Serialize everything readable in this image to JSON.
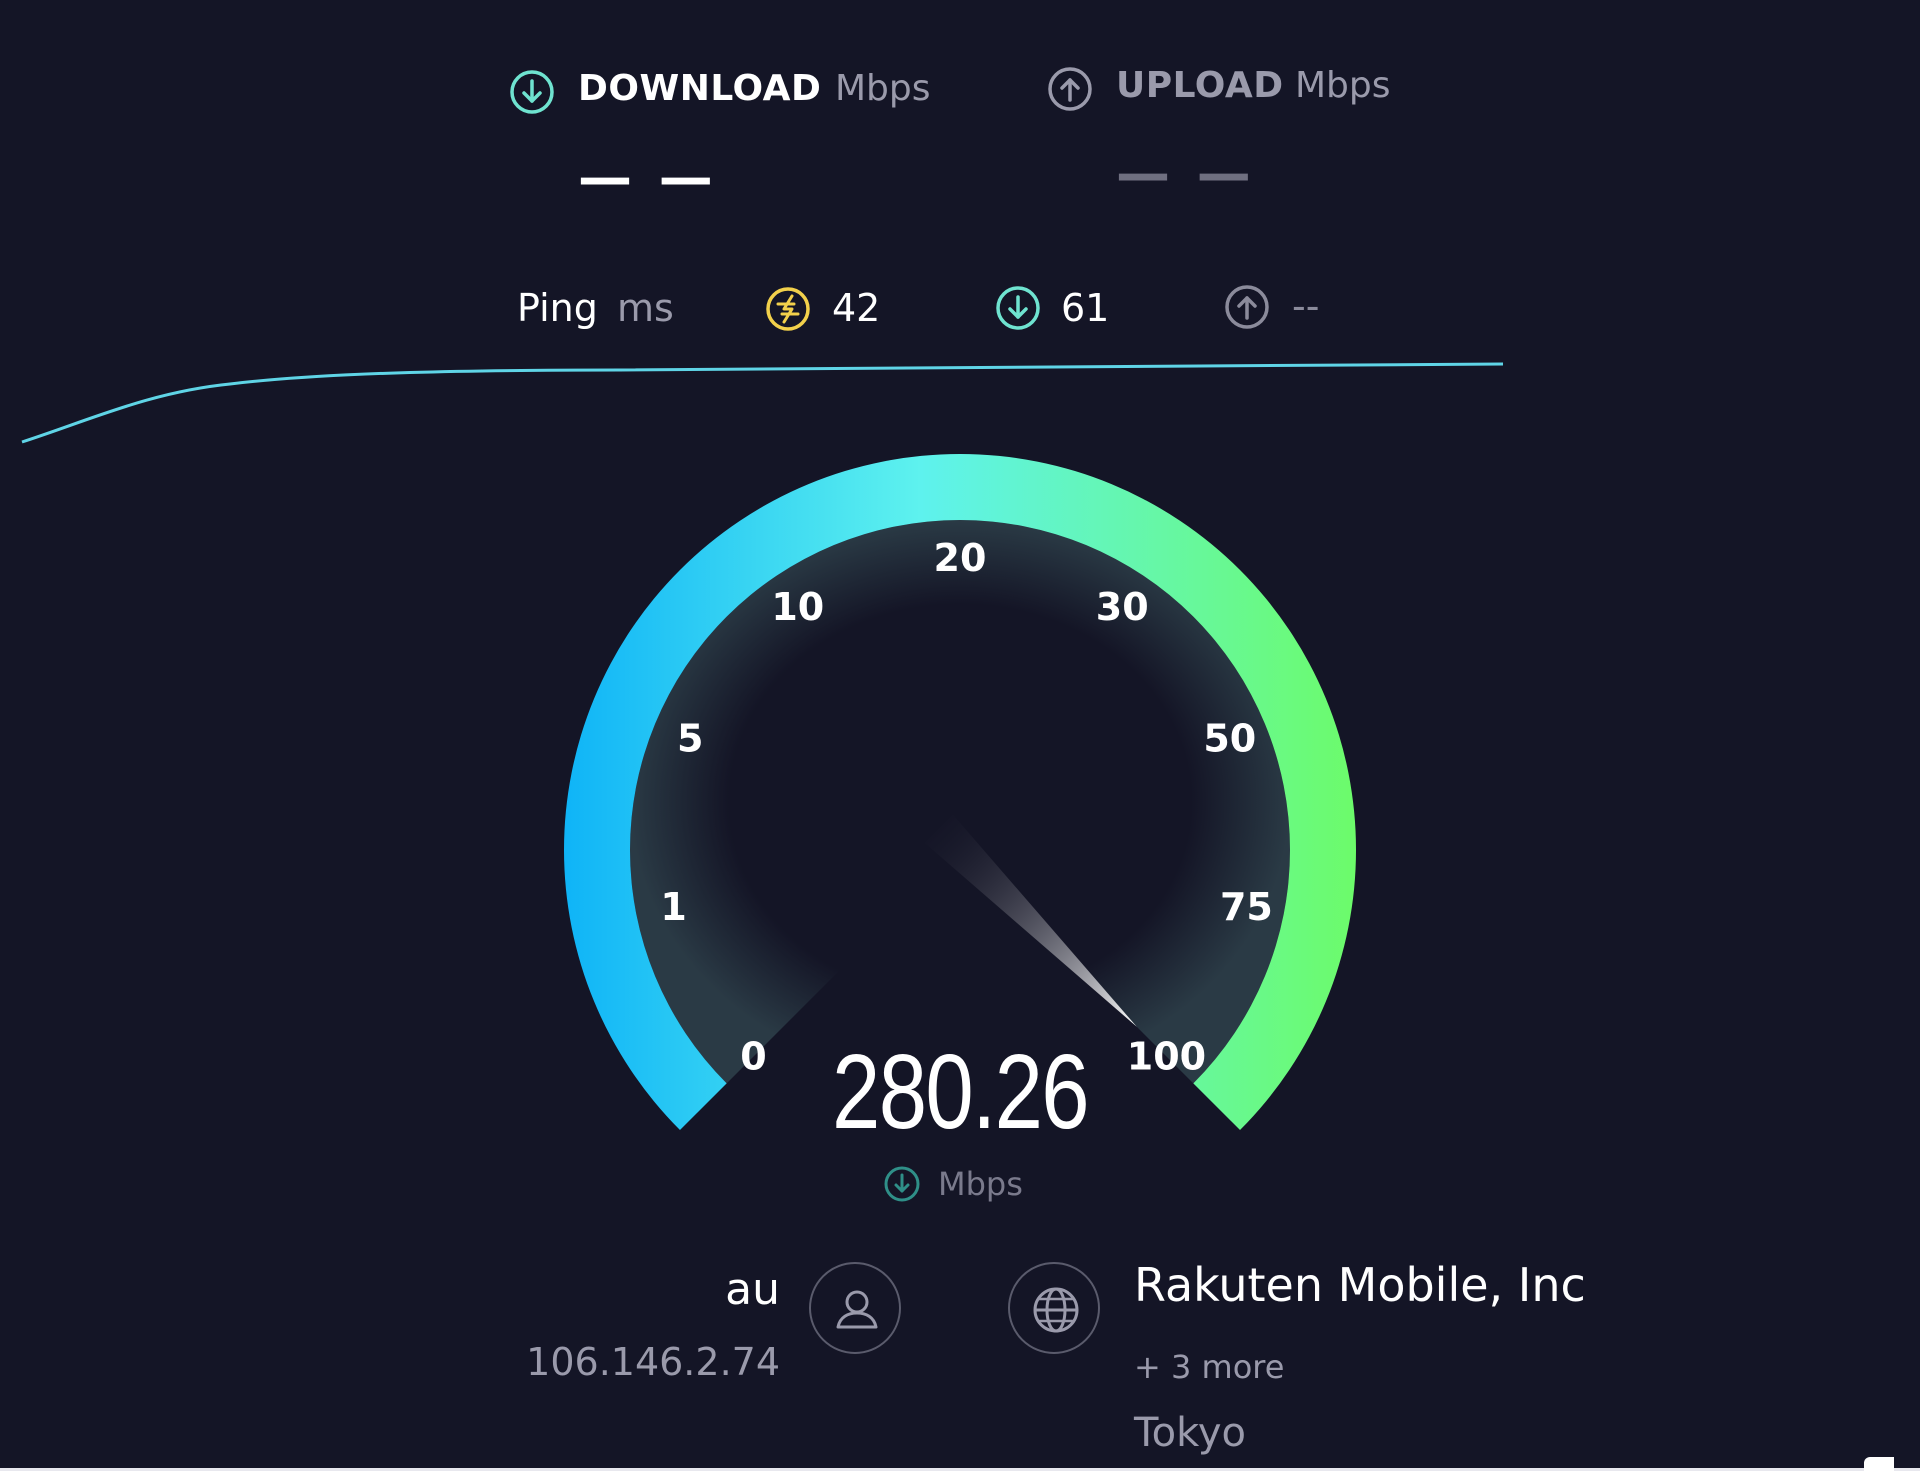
{
  "header": {
    "download": {
      "label": "DOWNLOAD",
      "unit": "Mbps",
      "value": "— —",
      "icon": "download-arrow-icon",
      "color": "#6fe3d0"
    },
    "upload": {
      "label": "UPLOAD",
      "unit": "Mbps",
      "value": "— —",
      "icon": "upload-arrow-icon",
      "color": "#9a9aab"
    }
  },
  "ping": {
    "label": "Ping",
    "unit": "ms",
    "idle": {
      "value": "42",
      "icon": "ping-idle-icon",
      "color": "#f2d04b"
    },
    "download": {
      "value": "61",
      "icon": "download-arrow-icon",
      "color": "#6fe3d0"
    },
    "upload": {
      "value": "--",
      "icon": "upload-arrow-icon",
      "color": "#8b8b9b"
    }
  },
  "gauge": {
    "scale_labels": [
      "0",
      "1",
      "5",
      "10",
      "20",
      "30",
      "50",
      "75",
      "100"
    ],
    "speed": "280.26",
    "speed_unit": "Mbps",
    "needle_value": 100,
    "gradient_start": "#0fb4f7",
    "gradient_mid": "#5ef2ee",
    "gradient_end": "#6cfb6a"
  },
  "isp": {
    "name": "au",
    "ip": "106.146.2.74",
    "icon": "user-icon"
  },
  "server": {
    "name": "Rakuten Mobile, Inc",
    "more": "+ 3 more",
    "location": "Tokyo",
    "icon": "globe-icon"
  }
}
